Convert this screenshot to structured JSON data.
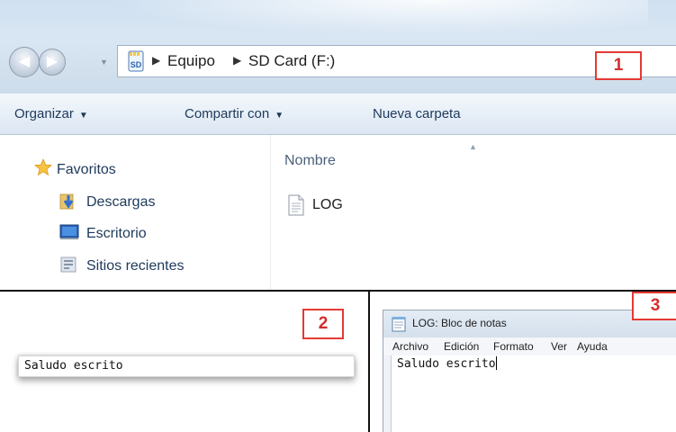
{
  "explorer": {
    "breadcrumb": [
      "Equipo",
      "SD Card (F:)"
    ],
    "address_icon_text": "SD",
    "toolbar": {
      "organize": "Organizar",
      "share": "Compartir con",
      "new_folder": "Nueva carpeta"
    },
    "sidebar": {
      "favorites": "Favoritos",
      "items": [
        "Descargas",
        "Escritorio",
        "Sitios recientes"
      ]
    },
    "filelist": {
      "column_name": "Nombre",
      "files": [
        "LOG"
      ]
    }
  },
  "labels": [
    "1",
    "2",
    "3"
  ],
  "panel2": {
    "console_text": "Saludo escrito"
  },
  "notepad": {
    "title": "LOG: Bloc de notas",
    "menu": [
      "Archivo",
      "Edición",
      "Formato",
      "Ver",
      "Ayuda"
    ],
    "content": "Saludo escrito"
  },
  "colors": {
    "label_border": "#e53935",
    "label_text": "#d32f2f",
    "toolbar_text": "#1e395b"
  }
}
